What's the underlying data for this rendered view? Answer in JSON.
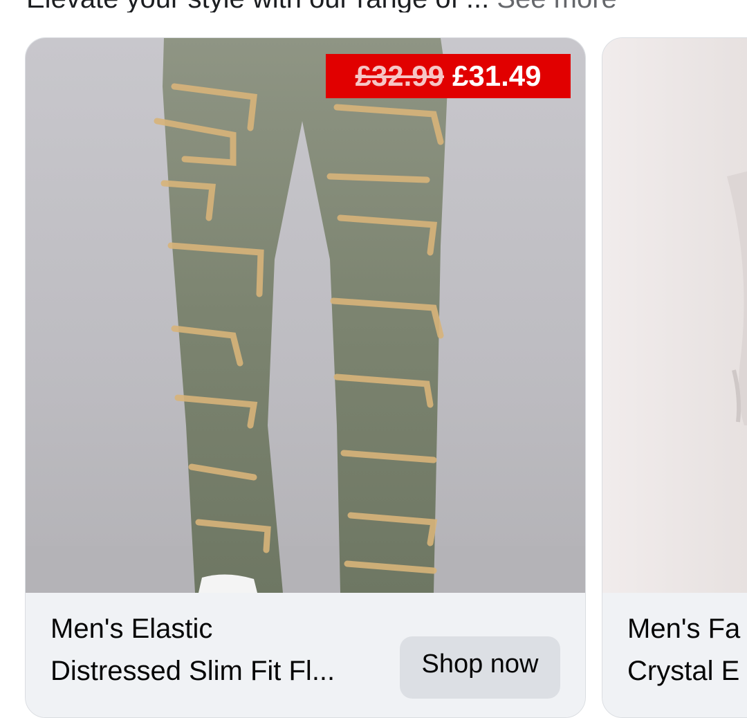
{
  "caption": {
    "text": "Elevate your style with our range of ...",
    "see_more": "See more"
  },
  "cards": [
    {
      "image": "distressed-jeans-product-photo",
      "price_old": "£32.99",
      "price_new": "£31.49",
      "title_line1": "Men's Elastic",
      "title_line2": "Distressed Slim Fit Fl...",
      "cta": "Shop now"
    },
    {
      "image": "product-photo-light-background",
      "title_line1": "Men's Fa",
      "title_line2": "Crystal E"
    }
  ],
  "colors": {
    "price_badge": "#e10000",
    "card_footer": "#f0f2f5",
    "button": "#dcdfe4",
    "muted_text": "#65676b"
  }
}
